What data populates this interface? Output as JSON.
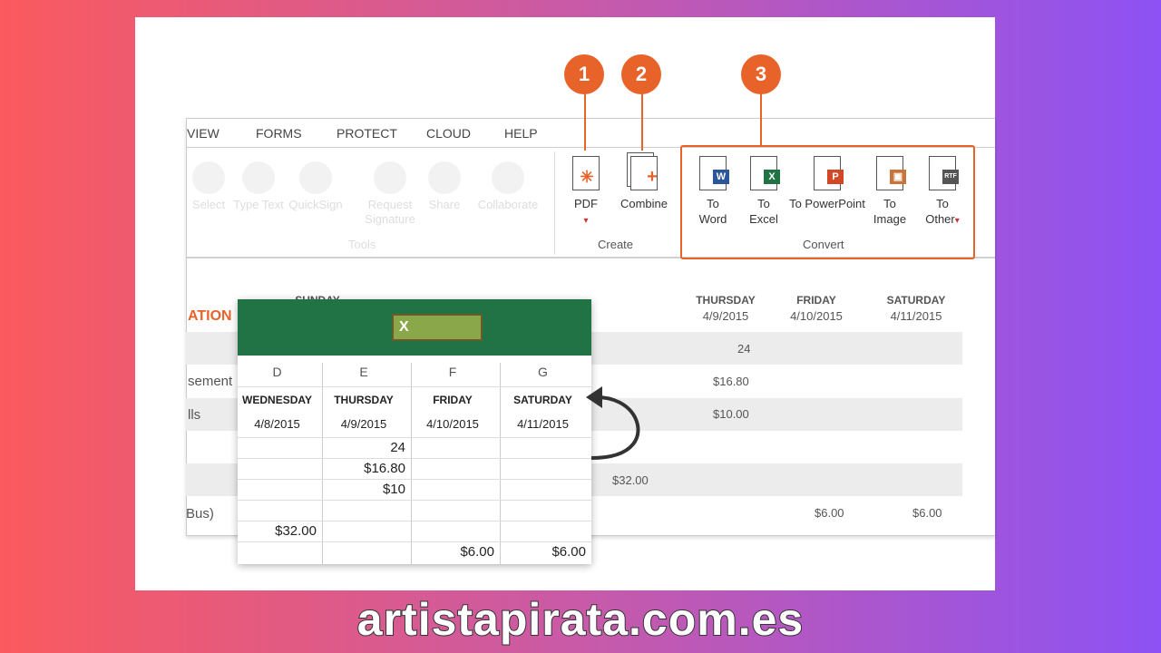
{
  "tabs": [
    "VIEW",
    "FORMS",
    "PROTECT",
    "CLOUD",
    "HELP"
  ],
  "tools": [
    {
      "label": "Select",
      "icon": "cursor-icon"
    },
    {
      "label": "Type Text",
      "icon": "text-icon"
    },
    {
      "label": "QuickSign",
      "icon": "pen-icon"
    },
    {
      "label": "Request Signature",
      "icon": "cloud-sign-icon"
    },
    {
      "label": "Share",
      "icon": "share-cloud-icon"
    },
    {
      "label": "Collaborate",
      "icon": "collaborate-icon"
    }
  ],
  "groups": {
    "tools": "Tools",
    "create": "Create",
    "convert": "Convert"
  },
  "create": [
    {
      "label": "PDF",
      "dropdown": "▾"
    },
    {
      "label": "Combine"
    }
  ],
  "convert": [
    {
      "label": "To Word",
      "badge": "W",
      "color": "#2b579a"
    },
    {
      "label": "To Excel",
      "badge": "X",
      "color": "#217346"
    },
    {
      "label": "To PowerPoint",
      "badge": "P",
      "color": "#d24726"
    },
    {
      "label": "To Image",
      "badge": "▣",
      "color": "#c9743a"
    },
    {
      "label": "To Other",
      "badge": "RTF",
      "color": "#555",
      "dropdown": "▾"
    }
  ],
  "callouts": [
    "1",
    "2",
    "3"
  ],
  "accent": "#e8632a",
  "background_table": {
    "section_label": "ATION",
    "headers": [
      {
        "day": "SUNDAY"
      },
      {
        "day": "THURSDAY",
        "date": "4/9/2015"
      },
      {
        "day": "FRIDAY",
        "date": "4/10/2015"
      },
      {
        "day": "SATURDAY",
        "date": "4/11/2015"
      }
    ],
    "row_labels": [
      "sement",
      "lls",
      "Bus)"
    ],
    "values": {
      "thursday": [
        "24",
        "$16.80",
        "$10.00"
      ],
      "wednesday": "$32.00",
      "friday": "$6.00",
      "saturday": "$6.00"
    }
  },
  "excel": {
    "logo": "X",
    "columns": [
      "D",
      "E",
      "F",
      "G"
    ],
    "days": [
      "WEDNESDAY",
      "THURSDAY",
      "FRIDAY",
      "SATURDAY"
    ],
    "dates": [
      "4/8/2015",
      "4/9/2015",
      "4/10/2015",
      "4/11/2015"
    ],
    "rows": [
      [
        "",
        "24",
        "",
        ""
      ],
      [
        "",
        "$16.80",
        "",
        ""
      ],
      [
        "",
        "$10",
        "",
        ""
      ],
      [
        "",
        "",
        "",
        ""
      ],
      [
        "$32.00",
        "",
        "",
        ""
      ],
      [
        "",
        "",
        "$6.00",
        "$6.00"
      ]
    ]
  },
  "watermark": "artistapirata.com.es"
}
